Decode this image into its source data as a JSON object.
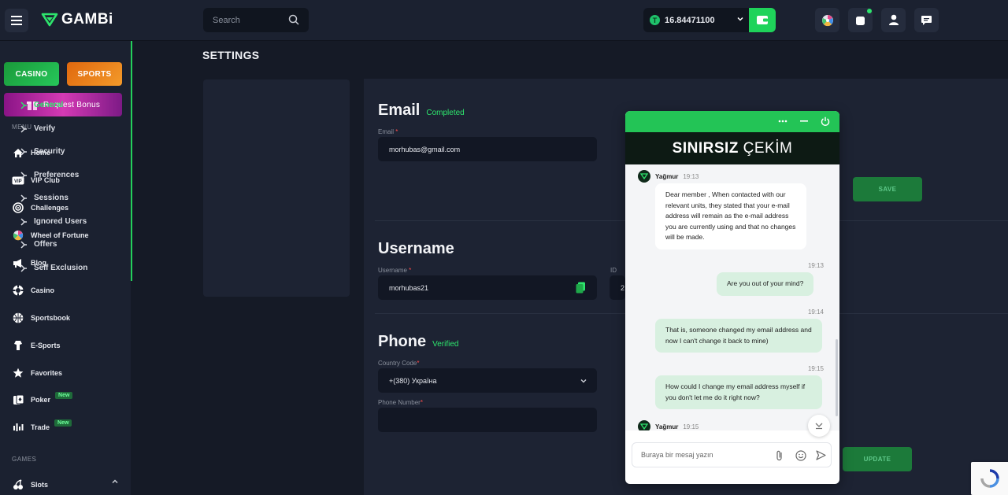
{
  "header": {
    "logo_text": "GAMBi",
    "search_placeholder": "Search",
    "balance_coin": "T",
    "balance": "16.84471100"
  },
  "sidebar": {
    "promo_casino": "CASINO",
    "promo_sports": "SPORTS",
    "promo_bonus": "Request Bonus",
    "menu_label": "MENU",
    "items": [
      {
        "label": "Home"
      },
      {
        "label": "VIP Club"
      },
      {
        "label": "Challenges"
      },
      {
        "label": "Wheel of Fortune"
      },
      {
        "label": "Blog"
      },
      {
        "label": "Casino"
      },
      {
        "label": "Sportsbook"
      },
      {
        "label": "E-Sports"
      },
      {
        "label": "Favorites"
      },
      {
        "label": "Poker",
        "badge": "New"
      },
      {
        "label": "Trade",
        "badge": "New"
      }
    ],
    "games_label": "GAMES",
    "games_items": [
      {
        "label": "Slots"
      }
    ]
  },
  "page": {
    "title": "SETTINGS"
  },
  "settings_nav": [
    {
      "label": "General",
      "active": true
    },
    {
      "label": "Verify"
    },
    {
      "label": "Security"
    },
    {
      "label": "Preferences"
    },
    {
      "label": "Sessions"
    },
    {
      "label": "Ignored Users"
    },
    {
      "label": "Offers"
    },
    {
      "label": "Self Exclusion"
    }
  ],
  "email": {
    "title": "Email",
    "status": "Completed",
    "label": "Email",
    "required": "*",
    "value": "morhubas@gmail.com",
    "save_label": "SAVE"
  },
  "username": {
    "title": "Username",
    "label": "Username",
    "required": "*",
    "value": "morhubas21",
    "id_label": "ID",
    "id_value": "2"
  },
  "phone": {
    "title": "Phone",
    "status": "Verified",
    "country_label": "Country Code",
    "required": "*",
    "country_value": "+(380) Україна",
    "number_label": "Phone Number",
    "number_value": "",
    "update_label": "UPDATE"
  },
  "chat": {
    "banner_a": "SINIRSIZ",
    "banner_b": "ÇEKİM",
    "messages": [
      {
        "from": "agent",
        "name": "Yağmur",
        "time": "19:13",
        "text": "Dear member , When contacted with our relevant units, they stated that your e-mail address will remain as the e-mail address you are currently using and that no changes will be made."
      },
      {
        "from": "user",
        "time": "19:13",
        "text": "Are you out of your mind?"
      },
      {
        "from": "user",
        "time": "19:14",
        "text": "That is, someone changed my email address and now I can't change it back to mine)"
      },
      {
        "from": "user",
        "time": "19:15",
        "text": "How could I change my email address myself if you don't let me do it right now?"
      },
      {
        "from": "agent",
        "name": "Yağmur",
        "time": "19:15",
        "text": ""
      }
    ],
    "input_placeholder": "Buraya bir mesaj yazın"
  },
  "colors": {
    "accent": "#23c456",
    "background": "#151a26",
    "panel": "#1d2333"
  }
}
